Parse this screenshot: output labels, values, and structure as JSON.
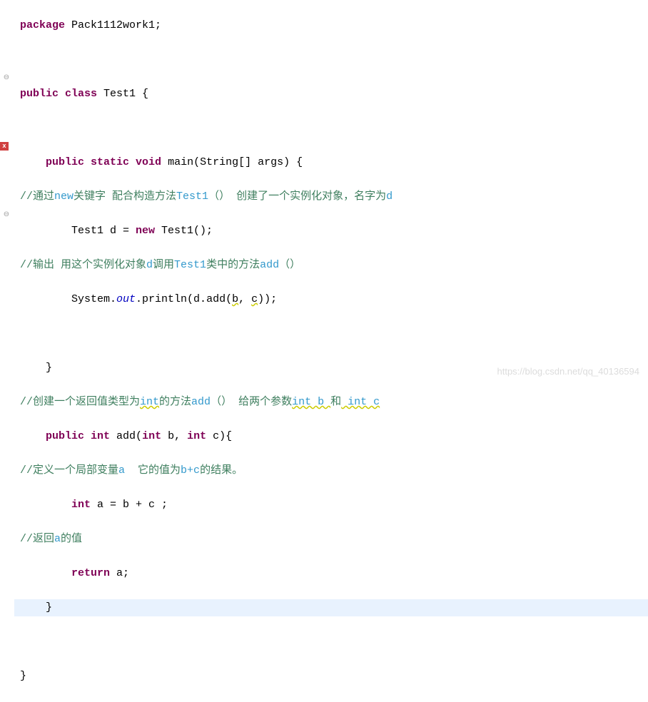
{
  "code": {
    "line1_package": "package",
    "line1_pkgname": " Pack1112work1;",
    "line3_public": "public",
    "line3_class": " class",
    "line3_name": " Test1 {",
    "line5_indent": "    ",
    "line5_public": "public",
    "line5_static": " static",
    "line5_void": " void",
    "line5_rest": " main(String[] args) {",
    "line6_comment_a": "//通过",
    "line6_comment_b": "new",
    "line6_comment_c": "关键字 配合构造方法",
    "line6_comment_d": "Test1",
    "line6_comment_e": "（） 创建了一个实例化对象，名字为",
    "line6_comment_f": "d",
    "line7_indent": "        ",
    "line7_text": "Test1 d = ",
    "line7_new": "new",
    "line7_rest": " Test1();",
    "line8_comment_a": "//输出 用这个实例化对象",
    "line8_comment_b": "d",
    "line8_comment_c": "调用",
    "line8_comment_d": "Test1",
    "line8_comment_e": "类中的方法",
    "line8_comment_f": "add",
    "line8_comment_g": "（）",
    "line9_indent": "        ",
    "line9_sys": "System.",
    "line9_out": "out",
    "line9_print": ".println(d.add(",
    "line9_b": "b",
    "line9_comma": ", ",
    "line9_c": "c",
    "line9_end": "));",
    "line11_brace": "    }",
    "line12_comment_a": "//创建一个返回值类型为",
    "line12_comment_b": "int",
    "line12_comment_c": "的方法",
    "line12_comment_d": "add",
    "line12_comment_e": "（） 给两个参数",
    "line12_comment_f": "int b ",
    "line12_comment_g": "和",
    "line12_comment_h": " int c",
    "line13_indent": "    ",
    "line13_public": "public",
    "line13_int": " int",
    "line13_rest": " add(",
    "line13_int2": "int",
    "line13_b": " b, ",
    "line13_int3": "int",
    "line13_c": " c){",
    "line14_comment_a": "//定义一个局部变量",
    "line14_comment_b": "a ",
    "line14_comment_c": " 它的值为",
    "line14_comment_d": "b+c",
    "line14_comment_e": "的结果。",
    "line15_indent": "        ",
    "line15_int": "int",
    "line15_rest": " a = b + c ;",
    "line16_comment_a": "//返回",
    "line16_comment_b": "a",
    "line16_comment_c": "的值",
    "line17_indent": "        ",
    "line17_return": "return",
    "line17_rest": " a;",
    "line18_brace": "    }",
    "line20_brace": "}"
  },
  "gutter": {
    "collapse_icon": "⊖",
    "error_icon": "x"
  },
  "watermark": "https://blog.csdn.net/qq_40136594"
}
